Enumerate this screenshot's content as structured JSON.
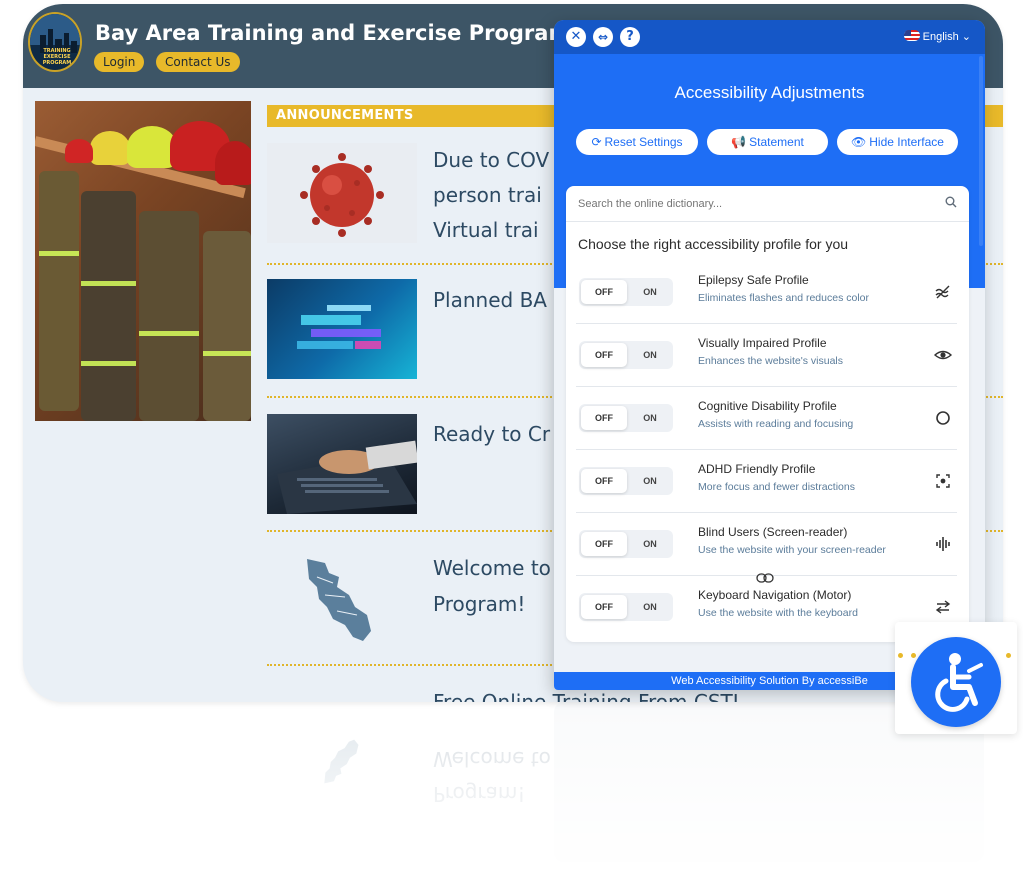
{
  "site": {
    "title": "Bay Area Training and Exercise Program",
    "login_label": "Login",
    "contact_label": "Contact Us",
    "logo_text": "TRAINING EXERCISE PROGRAM",
    "announcements_label": "ANNOUNCEMENTS",
    "items": [
      {
        "title_line1": "Due to COV",
        "title_line2": "person trai",
        "title_line3": "Virtual trai"
      },
      {
        "title_line1": "Planned BA"
      },
      {
        "title_line1": "Ready to Cr"
      },
      {
        "title_line1": "Welcome to",
        "title_line2": "Program!"
      }
    ],
    "cut_off_title": "Free Online Training From CSTI"
  },
  "panel": {
    "language": "English",
    "heading": "Accessibility Adjustments",
    "buttons": {
      "reset": "Reset Settings",
      "statement": "Statement",
      "hide": "Hide Interface"
    },
    "search_placeholder": "Search the online dictionary...",
    "choose_label": "Choose the right accessibility profile for you",
    "toggle_off": "OFF",
    "toggle_on": "ON",
    "profiles": [
      {
        "name": "Epilepsy Safe Profile",
        "desc": "Eliminates flashes and reduces color",
        "icon": "wave-strike-icon"
      },
      {
        "name": "Visually Impaired Profile",
        "desc": "Enhances the website's visuals",
        "icon": "eye-icon"
      },
      {
        "name": "Cognitive Disability Profile",
        "desc": "Assists with reading and focusing",
        "icon": "circle-icon"
      },
      {
        "name": "ADHD Friendly Profile",
        "desc": "More focus and fewer distractions",
        "icon": "focus-target-icon"
      },
      {
        "name": "Blind Users (Screen-reader)",
        "desc": "Use the website with your screen-reader",
        "icon": "audio-wave-icon"
      },
      {
        "name": "Keyboard Navigation (Motor)",
        "desc": "Use the website with the keyboard",
        "icon": "arrows-swap-icon"
      }
    ],
    "footer": "Web Accessibility Solution By accessiBe",
    "colors": {
      "accent": "#1e6ef5",
      "accent_dark": "#1557c7",
      "brand_gold": "#e8b92a",
      "header_slate": "#3d5566"
    }
  }
}
